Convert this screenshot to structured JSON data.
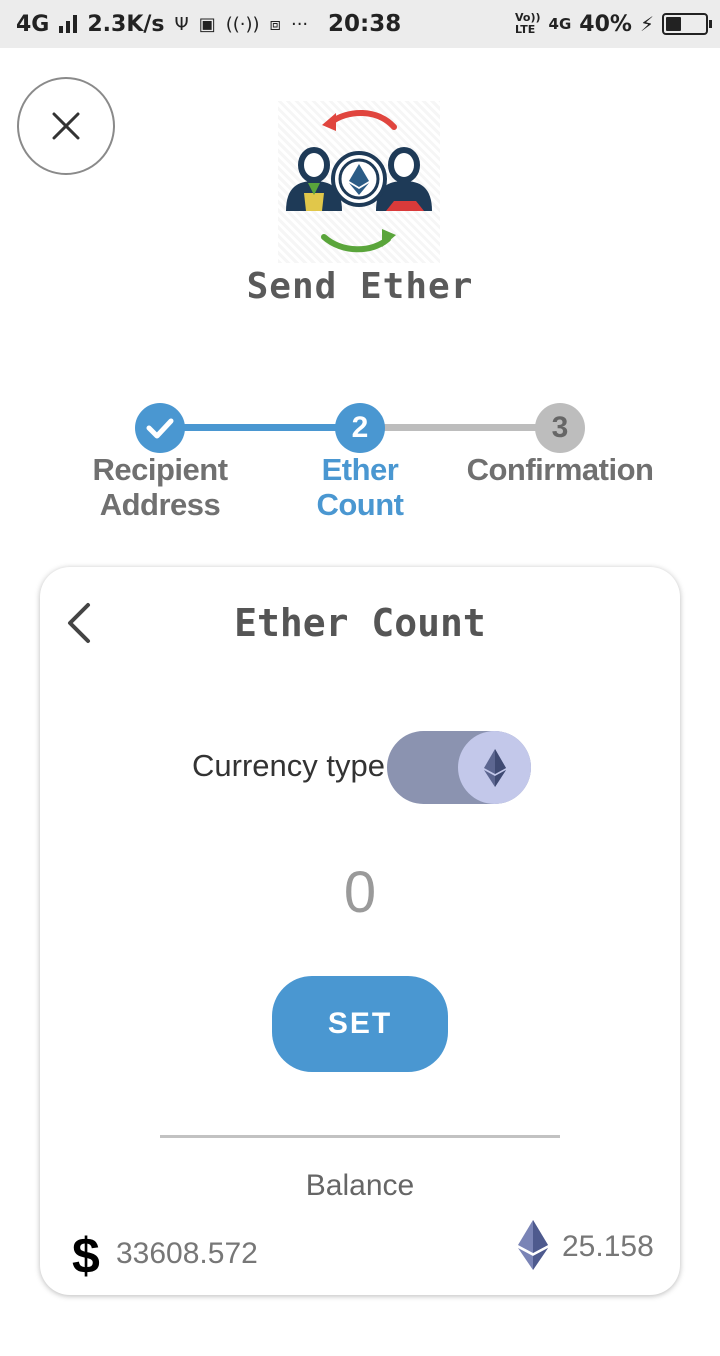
{
  "status_bar": {
    "network": "4G",
    "speed": "2.3K/s",
    "time": "20:38",
    "volte_top": "Vo))",
    "volte_bottom": "LTE",
    "network_right": "4G",
    "battery": "40%",
    "battery_level": 0.4
  },
  "header": {
    "title": "Send Ether"
  },
  "stepper": {
    "steps": [
      {
        "label_line1": "Recipient",
        "label_line2": "Address",
        "number": "",
        "state": "done"
      },
      {
        "label_line1": "Ether",
        "label_line2": "Count",
        "number": "2",
        "state": "active"
      },
      {
        "label_line1": "Confirmation",
        "label_line2": "",
        "number": "3",
        "state": "pending"
      }
    ]
  },
  "card": {
    "title": "Ether Count",
    "currency_label": "Currency type",
    "amount": "0",
    "set_label": "SET",
    "balance_label": "Balance",
    "usd_symbol": "$",
    "usd_value": "33608.572",
    "eth_value": "25.158"
  },
  "colors": {
    "accent": "#4a97d1",
    "pending": "#bdbdbd",
    "toggle_track": "#8b93b0",
    "toggle_knob": "#c3c8ea"
  }
}
